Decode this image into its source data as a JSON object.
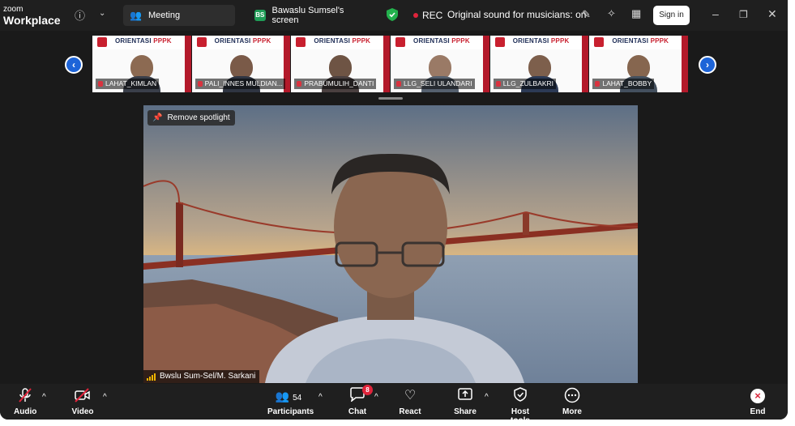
{
  "titlebar": {
    "brand_top": "zoom",
    "brand_bottom": "Workplace",
    "tab_meeting": "Meeting",
    "tab_screen_badge": "BS",
    "tab_screen": "Bawaslu Sumsel's screen",
    "rec_label": "REC",
    "sound_label": "Original sound for musicians: on",
    "signin_label": "Sign in"
  },
  "participants_strip": {
    "banner_title": "ORIENTASI",
    "banner_accent": "PPPK",
    "tiles": [
      {
        "name": "LAHAT_KIMLAN"
      },
      {
        "name": "PALI_INNES MULDIAN..."
      },
      {
        "name": "PRABUMULIH_DANTI"
      },
      {
        "name": "LLG_SELI ULANDARI"
      },
      {
        "name": "LLG_ZULBAKRI"
      },
      {
        "name": "LAHAT_BOBBY"
      }
    ]
  },
  "spotlight": {
    "remove_label": "Remove spotlight",
    "speaker_name": "Bwslu Sum-Sel/M. Sarkani"
  },
  "toolbar": {
    "audio": "Audio",
    "video": "Video",
    "participants": "Participants",
    "participants_count": "54",
    "chat": "Chat",
    "chat_badge": "8",
    "react": "React",
    "share": "Share",
    "host_tools": "Host tools",
    "more": "More",
    "end": "End"
  },
  "colors": {
    "accent_blue": "#1d64d8",
    "rec_red": "#e0243b",
    "bg_dark": "#1a1a1a",
    "brand_red": "#c8202f"
  }
}
